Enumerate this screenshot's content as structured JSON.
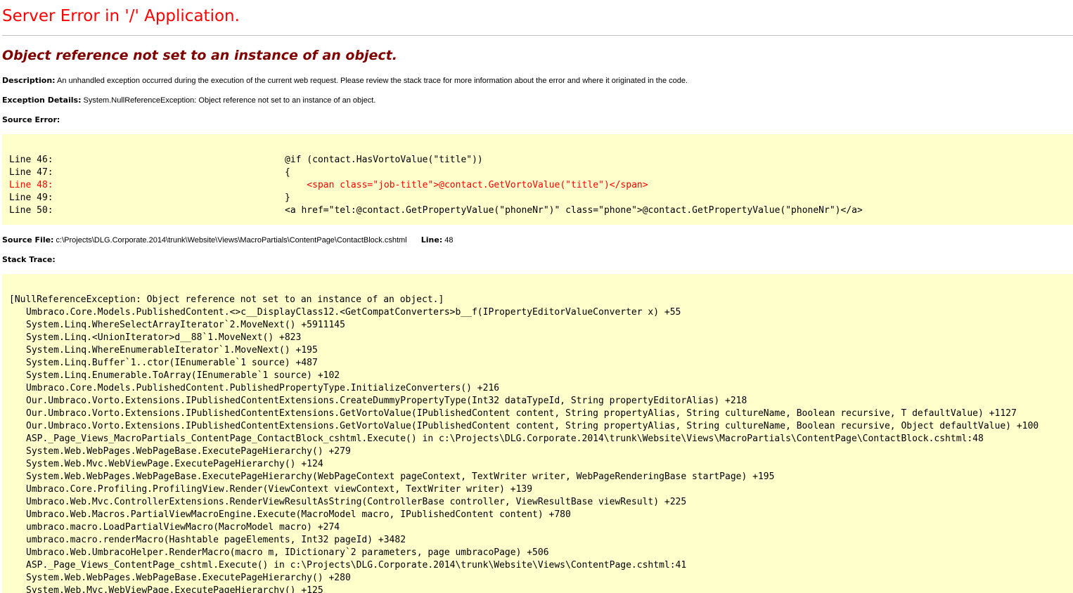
{
  "page": {
    "title": "Server Error in '/' Application.",
    "subtitle": "Object reference not set to an instance of an object.",
    "description_label": "Description:",
    "description_text": "An unhandled exception occurred during the execution of the current web request. Please review the stack trace for more information about the error and where it originated in the code.",
    "exception_label": "Exception Details:",
    "exception_text": "System.NullReferenceException: Object reference not set to an instance of an object.",
    "source_error_label": "Source Error:",
    "source_file_label": "Source File:",
    "source_file_path": "c:\\Projects\\DLG.Corporate.2014\\trunk\\Website\\Views\\MacroPartials\\ContentPage\\ContactBlock.cshtml",
    "line_label": "Line:",
    "line_value": "48",
    "stack_trace_label": "Stack Trace:"
  },
  "source_error": {
    "lines": [
      {
        "num": "Line 46:",
        "code": "@if (contact.HasVortoValue(\"title\"))",
        "error": false
      },
      {
        "num": "Line 47:",
        "code": "{",
        "error": false
      },
      {
        "num": "Line 48:",
        "code": "    <span class=\"job-title\">@contact.GetVortoValue(\"title\")</span>",
        "error": true
      },
      {
        "num": "Line 49:",
        "code": "}",
        "error": false
      },
      {
        "num": "Line 50:",
        "code": "<a href=\"tel:@contact.GetPropertyValue(\"phoneNr\")\" class=\"phone\">@contact.GetPropertyValue(\"phoneNr\")</a>",
        "error": false
      }
    ]
  },
  "stack_trace": {
    "header": "[NullReferenceException: Object reference not set to an instance of an object.]",
    "lines": [
      "Umbraco.Core.Models.PublishedContent.<>c__DisplayClass12.<GetCompatConverters>b__f(IPropertyEditorValueConverter x) +55",
      "System.Linq.WhereSelectArrayIterator`2.MoveNext() +5911145",
      "System.Linq.<UnionIterator>d__88`1.MoveNext() +823",
      "System.Linq.WhereEnumerableIterator`1.MoveNext() +195",
      "System.Linq.Buffer`1..ctor(IEnumerable`1 source) +487",
      "System.Linq.Enumerable.ToArray(IEnumerable`1 source) +102",
      "Umbraco.Core.Models.PublishedContent.PublishedPropertyType.InitializeConverters() +216",
      "Our.Umbraco.Vorto.Extensions.IPublishedContentExtensions.CreateDummyPropertyType(Int32 dataTypeId, String propertyEditorAlias) +218",
      "Our.Umbraco.Vorto.Extensions.IPublishedContentExtensions.GetVortoValue(IPublishedContent content, String propertyAlias, String cultureName, Boolean recursive, T defaultValue) +1127",
      "Our.Umbraco.Vorto.Extensions.IPublishedContentExtensions.GetVortoValue(IPublishedContent content, String propertyAlias, String cultureName, Boolean recursive, Object defaultValue) +100",
      "ASP._Page_Views_MacroPartials_ContentPage_ContactBlock_cshtml.Execute() in c:\\Projects\\DLG.Corporate.2014\\trunk\\Website\\Views\\MacroPartials\\ContentPage\\ContactBlock.cshtml:48",
      "System.Web.WebPages.WebPageBase.ExecutePageHierarchy() +279",
      "System.Web.Mvc.WebViewPage.ExecutePageHierarchy() +124",
      "System.Web.WebPages.WebPageBase.ExecutePageHierarchy(WebPageContext pageContext, TextWriter writer, WebPageRenderingBase startPage) +195",
      "Umbraco.Core.Profiling.ProfilingView.Render(ViewContext viewContext, TextWriter writer) +139",
      "Umbraco.Web.Mvc.ControllerExtensions.RenderViewResultAsString(ControllerBase controller, ViewResultBase viewResult) +225",
      "Umbraco.Web.Macros.PartialViewMacroEngine.Execute(MacroModel macro, IPublishedContent content) +780",
      "umbraco.macro.LoadPartialViewMacro(MacroModel macro) +274",
      "umbraco.macro.renderMacro(Hashtable pageElements, Int32 pageId) +3482",
      "Umbraco.Web.UmbracoHelper.RenderMacro(macro m, IDictionary`2 parameters, page umbracoPage) +506",
      "ASP._Page_Views_ContentPage_cshtml.Execute() in c:\\Projects\\DLG.Corporate.2014\\trunk\\Website\\Views\\ContentPage.cshtml:41",
      "System.Web.WebPages.WebPageBase.ExecutePageHierarchy() +280",
      "System.Web.Mvc.WebViewPage.ExecutePageHierarchy() +125"
    ]
  },
  "colors": {
    "title": "#ff0000",
    "subtitle": "#800000",
    "code_background": "#ffffcc",
    "error_line": "#ff0000",
    "rule": "#c0c0c0"
  }
}
